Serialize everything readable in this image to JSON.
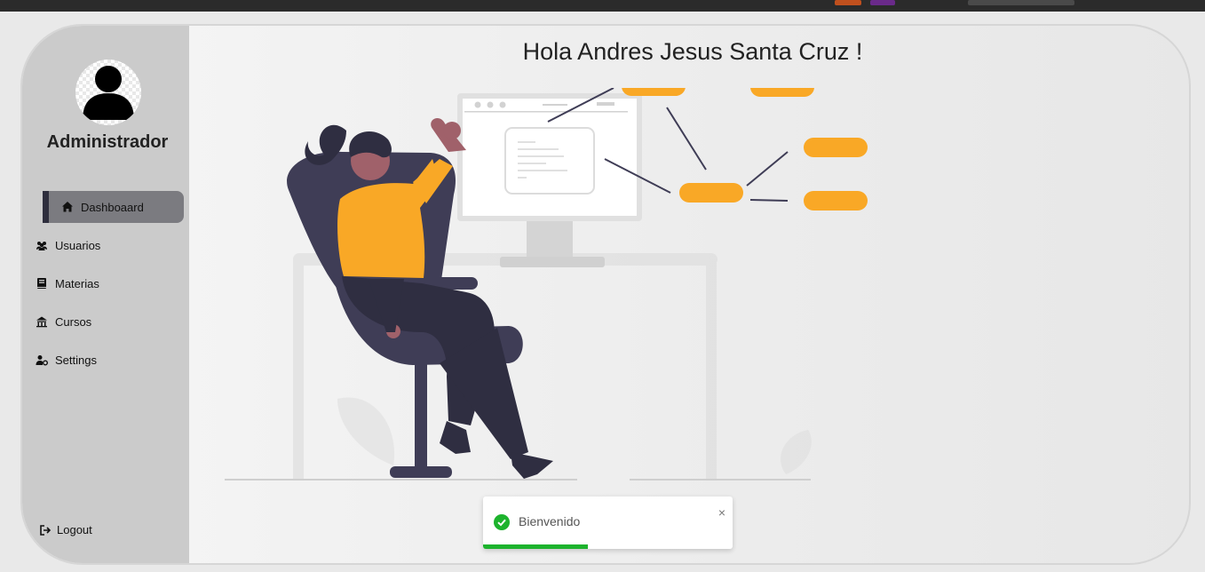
{
  "user": {
    "greeting": "Hola Andres Jesus Santa Cruz !",
    "role": "Administrador"
  },
  "sidebar": {
    "items": [
      {
        "label": "Dashboaard",
        "icon": "home-icon",
        "active": true
      },
      {
        "label": "Usuarios",
        "icon": "users-icon",
        "active": false
      },
      {
        "label": "Materias",
        "icon": "book-icon",
        "active": false
      },
      {
        "label": "Cursos",
        "icon": "school-icon",
        "active": false
      },
      {
        "label": "Settings",
        "icon": "user-gear-icon",
        "active": false
      }
    ],
    "logout_label": "Logout"
  },
  "toast": {
    "message": "Bienvenido",
    "close_symbol": "×",
    "progress": 0.42
  },
  "colors": {
    "accent": "#f9a826",
    "dark": "#3f3d56",
    "success": "#1db32d"
  }
}
